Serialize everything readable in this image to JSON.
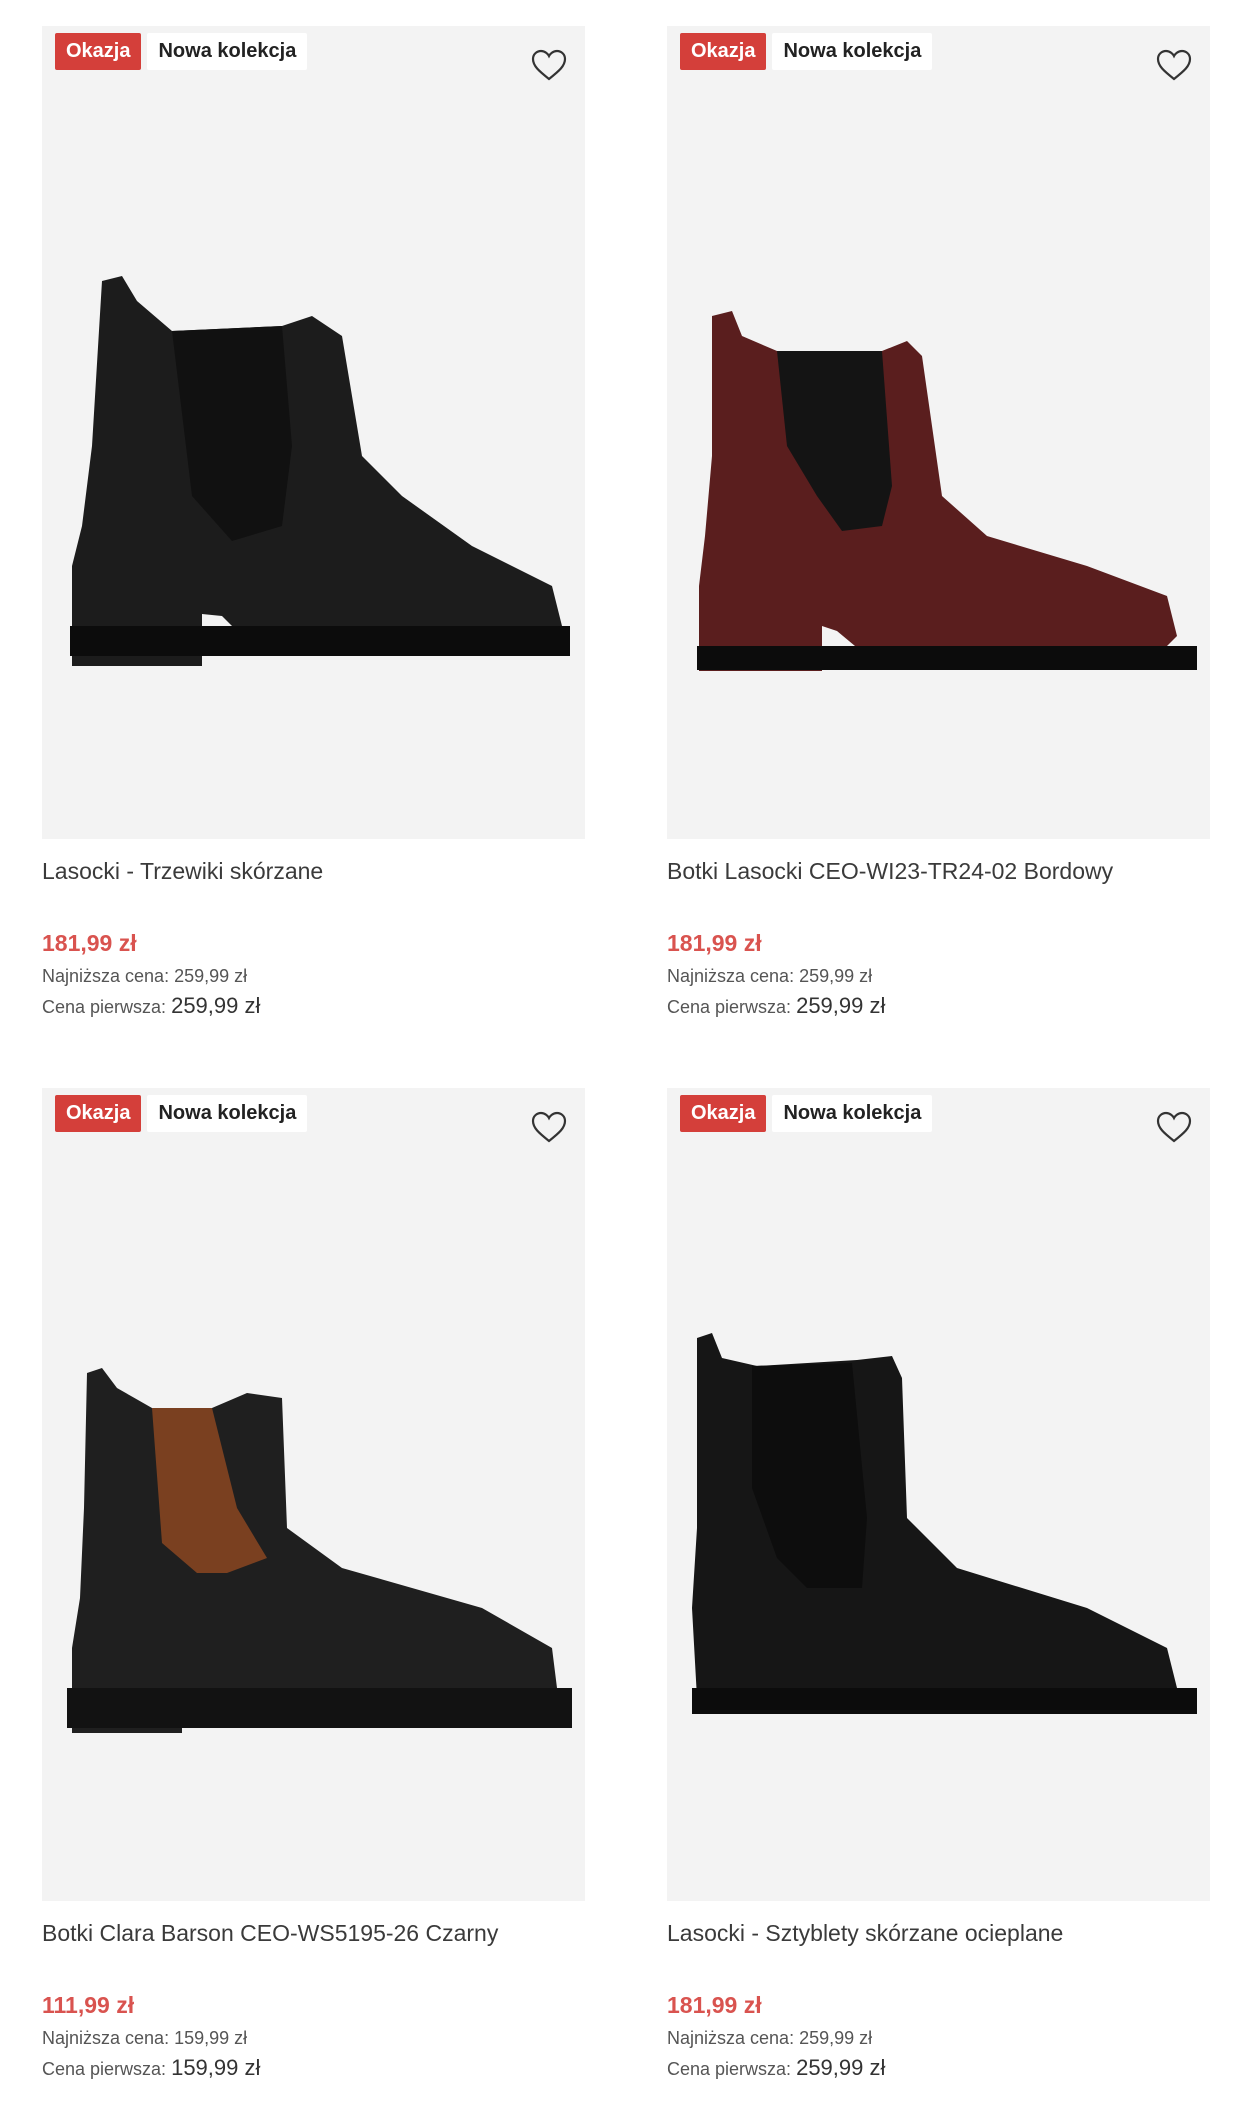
{
  "products": [
    {
      "badge_deal": "Okazja",
      "badge_new": "Nowa kolekcja",
      "title": "Lasocki - Trzewiki skórzane",
      "price": "181,99 zł",
      "lowest_label": "Najniższa cena:",
      "lowest_value": "259,99 zł",
      "first_label": "Cena pierwsza:",
      "first_value": "259,99 zł",
      "boot_color": "#1c1c1c",
      "panel_color": "#111111"
    },
    {
      "badge_deal": "Okazja",
      "badge_new": "Nowa kolekcja",
      "title": "Botki Lasocki CEO-WI23-TR24-02 Bordowy",
      "price": "181,99 zł",
      "lowest_label": "Najniższa cena:",
      "lowest_value": "259,99 zł",
      "first_label": "Cena pierwsza:",
      "first_value": "259,99 zł",
      "boot_color": "#5a1e1e",
      "panel_color": "#141414"
    },
    {
      "badge_deal": "Okazja",
      "badge_new": "Nowa kolekcja",
      "title": "Botki Clara Barson CEO-WS5195-26 Czarny",
      "price": "111,99 zł",
      "lowest_label": "Najniższa cena:",
      "lowest_value": "159,99 zł",
      "first_label": "Cena pierwsza:",
      "first_value": "159,99 zł",
      "boot_color": "#1f1f1f",
      "panel_color": "#7a4020"
    },
    {
      "badge_deal": "Okazja",
      "badge_new": "Nowa kolekcja",
      "title": "Lasocki - Sztyblety skórzane ocieplane",
      "price": "181,99 zł",
      "lowest_label": "Najniższa cena:",
      "lowest_value": "259,99 zł",
      "first_label": "Cena pierwsza:",
      "first_value": "259,99 zł",
      "boot_color": "#161616",
      "panel_color": "#0d0d0d"
    }
  ]
}
